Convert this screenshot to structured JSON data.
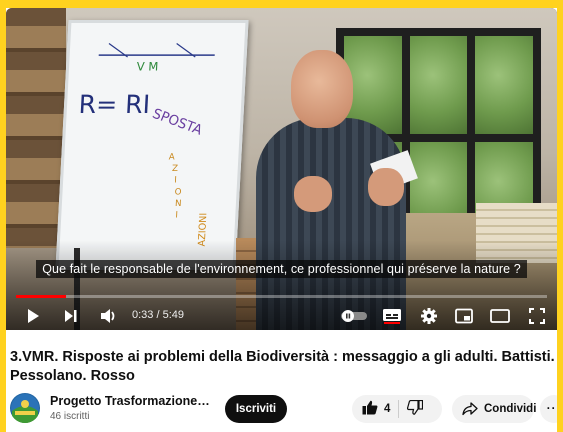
{
  "player": {
    "caption": "Que fait le responsable de l'environnement, ce professionnel qui préserve la nature ?",
    "time_display": "0:33 / 5:49",
    "progress_fraction": 0.094,
    "board_text_line1": "R= RI",
    "board_text_risposta": "SPOSTA",
    "board_text_azioni": "AZIONI",
    "board_text_top": "V M"
  },
  "video": {
    "title": "3.VMR. Risposte ai problemi della Biodiversità : messaggio a gli adulti. Battisti. Pessolano. Rosso"
  },
  "channel": {
    "name": "Progetto Trasformazione ...",
    "subscribers": "46 iscritti",
    "subscribe_label": "Iscriviti"
  },
  "actions": {
    "like_count": "4",
    "share_label": "Condividi",
    "more_label": "···"
  },
  "colors": {
    "background_border": "#ffd21f",
    "progress_played": "#ff0000",
    "subscribe_bg": "#0f0f0f"
  }
}
